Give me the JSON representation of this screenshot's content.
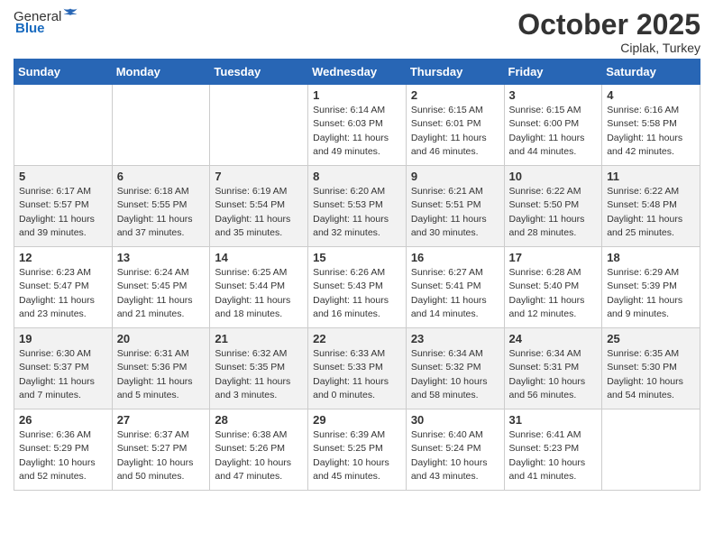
{
  "header": {
    "logo_general": "General",
    "logo_blue": "Blue",
    "title": "October 2025",
    "subtitle": "Ciplak, Turkey"
  },
  "days_of_week": [
    "Sunday",
    "Monday",
    "Tuesday",
    "Wednesday",
    "Thursday",
    "Friday",
    "Saturday"
  ],
  "weeks": [
    [
      {
        "day": "",
        "info": ""
      },
      {
        "day": "",
        "info": ""
      },
      {
        "day": "",
        "info": ""
      },
      {
        "day": "1",
        "info": "Sunrise: 6:14 AM\nSunset: 6:03 PM\nDaylight: 11 hours\nand 49 minutes."
      },
      {
        "day": "2",
        "info": "Sunrise: 6:15 AM\nSunset: 6:01 PM\nDaylight: 11 hours\nand 46 minutes."
      },
      {
        "day": "3",
        "info": "Sunrise: 6:15 AM\nSunset: 6:00 PM\nDaylight: 11 hours\nand 44 minutes."
      },
      {
        "day": "4",
        "info": "Sunrise: 6:16 AM\nSunset: 5:58 PM\nDaylight: 11 hours\nand 42 minutes."
      }
    ],
    [
      {
        "day": "5",
        "info": "Sunrise: 6:17 AM\nSunset: 5:57 PM\nDaylight: 11 hours\nand 39 minutes."
      },
      {
        "day": "6",
        "info": "Sunrise: 6:18 AM\nSunset: 5:55 PM\nDaylight: 11 hours\nand 37 minutes."
      },
      {
        "day": "7",
        "info": "Sunrise: 6:19 AM\nSunset: 5:54 PM\nDaylight: 11 hours\nand 35 minutes."
      },
      {
        "day": "8",
        "info": "Sunrise: 6:20 AM\nSunset: 5:53 PM\nDaylight: 11 hours\nand 32 minutes."
      },
      {
        "day": "9",
        "info": "Sunrise: 6:21 AM\nSunset: 5:51 PM\nDaylight: 11 hours\nand 30 minutes."
      },
      {
        "day": "10",
        "info": "Sunrise: 6:22 AM\nSunset: 5:50 PM\nDaylight: 11 hours\nand 28 minutes."
      },
      {
        "day": "11",
        "info": "Sunrise: 6:22 AM\nSunset: 5:48 PM\nDaylight: 11 hours\nand 25 minutes."
      }
    ],
    [
      {
        "day": "12",
        "info": "Sunrise: 6:23 AM\nSunset: 5:47 PM\nDaylight: 11 hours\nand 23 minutes."
      },
      {
        "day": "13",
        "info": "Sunrise: 6:24 AM\nSunset: 5:45 PM\nDaylight: 11 hours\nand 21 minutes."
      },
      {
        "day": "14",
        "info": "Sunrise: 6:25 AM\nSunset: 5:44 PM\nDaylight: 11 hours\nand 18 minutes."
      },
      {
        "day": "15",
        "info": "Sunrise: 6:26 AM\nSunset: 5:43 PM\nDaylight: 11 hours\nand 16 minutes."
      },
      {
        "day": "16",
        "info": "Sunrise: 6:27 AM\nSunset: 5:41 PM\nDaylight: 11 hours\nand 14 minutes."
      },
      {
        "day": "17",
        "info": "Sunrise: 6:28 AM\nSunset: 5:40 PM\nDaylight: 11 hours\nand 12 minutes."
      },
      {
        "day": "18",
        "info": "Sunrise: 6:29 AM\nSunset: 5:39 PM\nDaylight: 11 hours\nand 9 minutes."
      }
    ],
    [
      {
        "day": "19",
        "info": "Sunrise: 6:30 AM\nSunset: 5:37 PM\nDaylight: 11 hours\nand 7 minutes."
      },
      {
        "day": "20",
        "info": "Sunrise: 6:31 AM\nSunset: 5:36 PM\nDaylight: 11 hours\nand 5 minutes."
      },
      {
        "day": "21",
        "info": "Sunrise: 6:32 AM\nSunset: 5:35 PM\nDaylight: 11 hours\nand 3 minutes."
      },
      {
        "day": "22",
        "info": "Sunrise: 6:33 AM\nSunset: 5:33 PM\nDaylight: 11 hours\nand 0 minutes."
      },
      {
        "day": "23",
        "info": "Sunrise: 6:34 AM\nSunset: 5:32 PM\nDaylight: 10 hours\nand 58 minutes."
      },
      {
        "day": "24",
        "info": "Sunrise: 6:34 AM\nSunset: 5:31 PM\nDaylight: 10 hours\nand 56 minutes."
      },
      {
        "day": "25",
        "info": "Sunrise: 6:35 AM\nSunset: 5:30 PM\nDaylight: 10 hours\nand 54 minutes."
      }
    ],
    [
      {
        "day": "26",
        "info": "Sunrise: 6:36 AM\nSunset: 5:29 PM\nDaylight: 10 hours\nand 52 minutes."
      },
      {
        "day": "27",
        "info": "Sunrise: 6:37 AM\nSunset: 5:27 PM\nDaylight: 10 hours\nand 50 minutes."
      },
      {
        "day": "28",
        "info": "Sunrise: 6:38 AM\nSunset: 5:26 PM\nDaylight: 10 hours\nand 47 minutes."
      },
      {
        "day": "29",
        "info": "Sunrise: 6:39 AM\nSunset: 5:25 PM\nDaylight: 10 hours\nand 45 minutes."
      },
      {
        "day": "30",
        "info": "Sunrise: 6:40 AM\nSunset: 5:24 PM\nDaylight: 10 hours\nand 43 minutes."
      },
      {
        "day": "31",
        "info": "Sunrise: 6:41 AM\nSunset: 5:23 PM\nDaylight: 10 hours\nand 41 minutes."
      },
      {
        "day": "",
        "info": ""
      }
    ]
  ]
}
